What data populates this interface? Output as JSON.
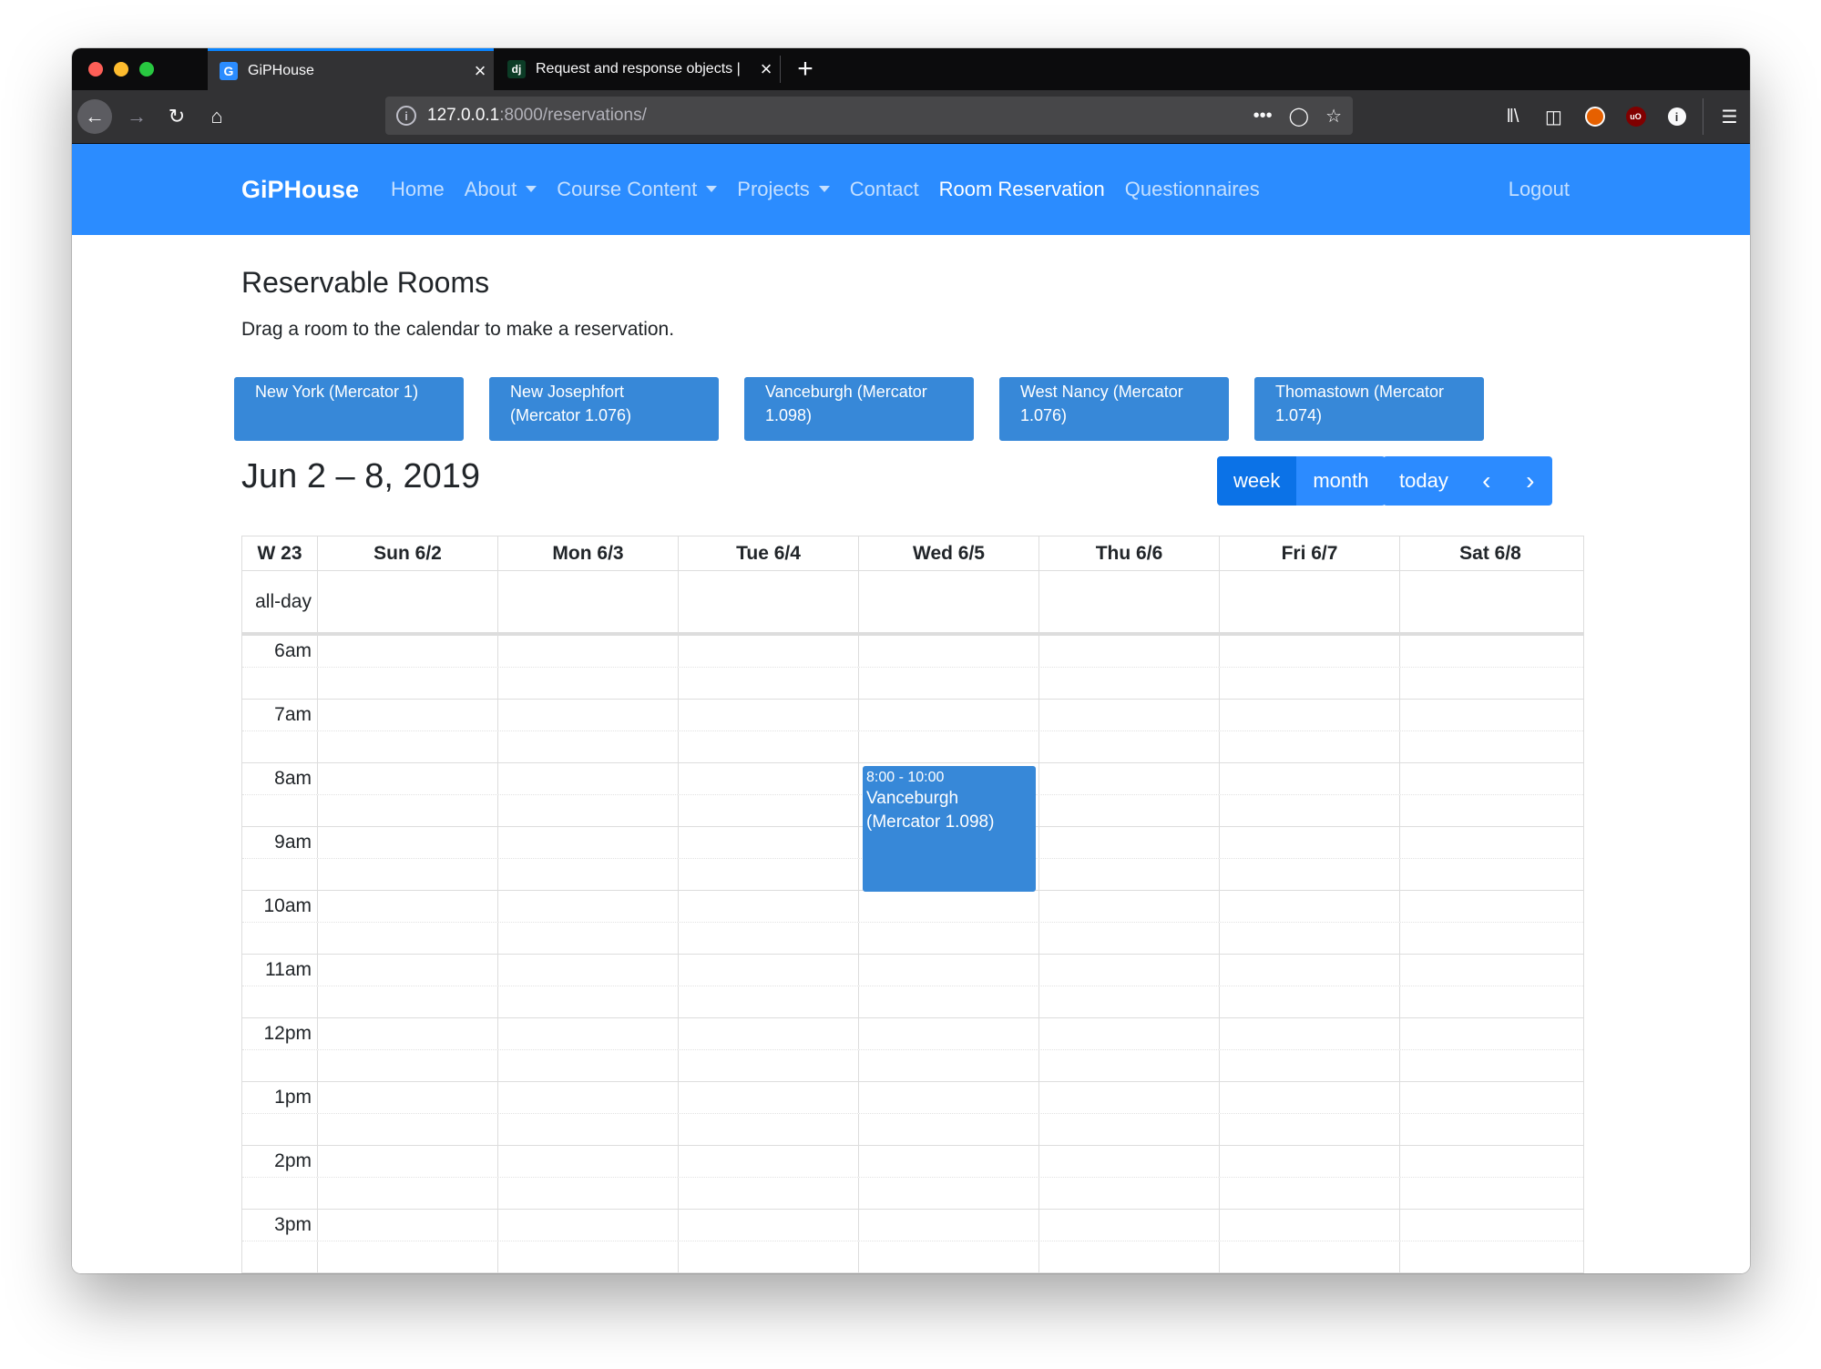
{
  "browser": {
    "tabs": [
      {
        "title": "GiPHouse",
        "icon": "G",
        "active": true
      },
      {
        "title": "Request and response objects |",
        "icon": "dj",
        "active": false
      }
    ],
    "url_host": "127.0.0.1",
    "url_rest": ":8000/reservations/"
  },
  "site": {
    "brand": "GiPHouse",
    "nav": [
      "Home",
      "About",
      "Course Content",
      "Projects",
      "Contact",
      "Room Reservation",
      "Questionnaires"
    ],
    "logout": "Logout"
  },
  "page": {
    "title": "Reservable Rooms",
    "subtitle": "Drag a room to the calendar to make a reservation.",
    "rooms": [
      "New York (Mercator 1)",
      "New Josephfort (Mercator 1.076)",
      "Vanceburgh (Mercator 1.098)",
      "West Nancy (Mercator 1.076)",
      "Thomastown (Mercator 1.074)"
    ]
  },
  "calendar": {
    "title": "Jun 2 – 8, 2019",
    "view_buttons": {
      "week": "week",
      "month": "month",
      "active": "week"
    },
    "today_label": "today",
    "week_number": "W 23",
    "days": [
      "Sun 6/2",
      "Mon 6/3",
      "Tue 6/4",
      "Wed 6/5",
      "Thu 6/6",
      "Fri 6/7",
      "Sat 6/8"
    ],
    "allday_label": "all-day",
    "times": [
      "6am",
      "7am",
      "8am",
      "9am",
      "10am",
      "11am",
      "12pm",
      "1pm",
      "2pm",
      "3pm"
    ],
    "events": [
      {
        "day": "Wed 6/5",
        "time": "8:00 - 10:00",
        "title": "Vanceburgh (Mercator 1.098)",
        "color": "#3788d8"
      }
    ]
  },
  "colors": {
    "navbar": "#2b8cff",
    "room": "#3788d8",
    "button": "#2c8bff",
    "button_active": "#0b72e7"
  }
}
